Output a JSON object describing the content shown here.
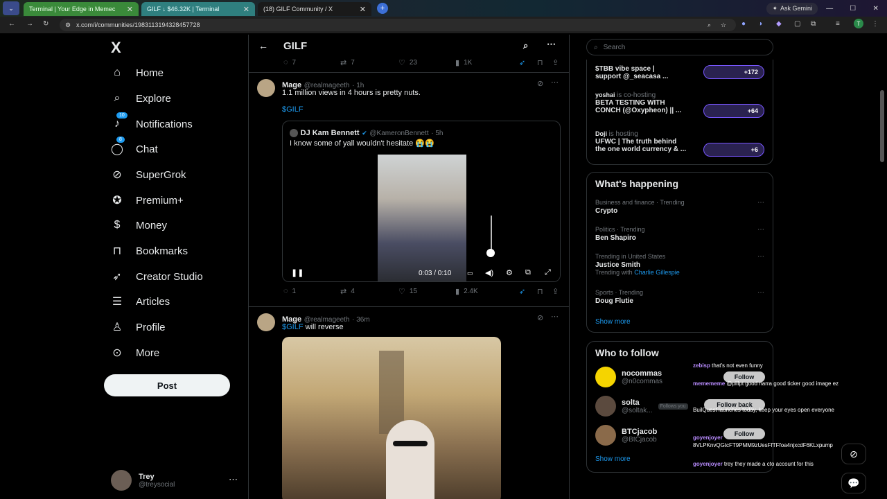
{
  "browser": {
    "tabs": [
      {
        "title": "Terminal | Your Edge in Memec",
        "bg": "#3a8a3a"
      },
      {
        "title": "GILF ↓ $46.32K | Terminal",
        "bg": "#2f7f7f"
      },
      {
        "title": "(18) GILF Community / X",
        "bg": "#222"
      }
    ],
    "new_tab": "+",
    "ask_gemini": "Ask Gemini",
    "url": "x.com/i/communities/1983113194328457728"
  },
  "nav": {
    "logo": "X",
    "items": [
      {
        "label": "Home",
        "icon": "home-icon",
        "glyph": "⌂"
      },
      {
        "label": "Explore",
        "icon": "search-icon",
        "glyph": "⌕"
      },
      {
        "label": "Notifications",
        "icon": "bell-icon",
        "glyph": "🔔",
        "badge": "10"
      },
      {
        "label": "Chat",
        "icon": "chat-icon",
        "glyph": "💬",
        "badge": "8"
      },
      {
        "label": "SuperGrok",
        "icon": "grok-icon",
        "glyph": "⊘"
      },
      {
        "label": "Premium+",
        "icon": "verified-icon",
        "glyph": "✪"
      },
      {
        "label": "Money",
        "icon": "money-icon",
        "glyph": "$"
      },
      {
        "label": "Bookmarks",
        "icon": "bookmark-icon",
        "glyph": "🔖"
      },
      {
        "label": "Creator Studio",
        "icon": "rocket-icon",
        "glyph": "🚀"
      },
      {
        "label": "Articles",
        "icon": "article-icon",
        "glyph": "☰"
      },
      {
        "label": "Profile",
        "icon": "profile-icon",
        "glyph": "👤"
      },
      {
        "label": "More",
        "icon": "more-icon",
        "glyph": "⋯"
      }
    ],
    "post": "Post",
    "me": {
      "name": "Trey",
      "handle": "@treysocial"
    }
  },
  "main": {
    "title": "GILF",
    "top_actions": {
      "replies": "7",
      "reposts": "7",
      "likes": "23",
      "views": "1K"
    },
    "tweet1": {
      "name": "Mage",
      "handle": "@realmageeth",
      "time": "· 1h",
      "text": "1.1 million views in 4 hours is pretty nuts.",
      "cashtag": "$GILF",
      "quote": {
        "name": "DJ Kam Bennett",
        "handle": "@KameronBennett",
        "time": "· 5h",
        "text": "I know some of yall wouldn't hesitate 😭😭",
        "video_time": "0:03 / 0:10"
      },
      "actions": {
        "replies": "1",
        "reposts": "4",
        "likes": "15",
        "views": "2.4K"
      }
    },
    "tweet2": {
      "name": "Mage",
      "handle": "@realmageeth",
      "time": "· 36m",
      "cashtag": "$GILF",
      "text": "will reverse"
    }
  },
  "right": {
    "search_placeholder": "Search",
    "spaces": [
      {
        "host": "",
        "hosting": "",
        "title": "$TBB vibe space |",
        "title2": "support @_seacasa ...",
        "count": "+172"
      },
      {
        "host": "yoshai",
        "hosting": "is co-hosting",
        "title": "BETA TESTING WITH",
        "title2": "CONCH (@Oxypheon) || ...",
        "count": "+64"
      },
      {
        "host": "Doji",
        "hosting": "is hosting",
        "title": "UFWC | The truth behind",
        "title2": "the one world currency & ...",
        "count": "+6"
      }
    ],
    "happening": {
      "title": "What's happening",
      "trends": [
        {
          "meta": "Business and finance · Trending",
          "name": "Crypto",
          "extra": ""
        },
        {
          "meta": "Politics · Trending",
          "name": "Ben Shapiro",
          "extra": ""
        },
        {
          "meta": "Trending in United States",
          "name": "Justice Smith",
          "extra": "Trending with",
          "extra_link": "Charlie Gillespie"
        },
        {
          "meta": "Sports · Trending",
          "name": "Doug Flutie",
          "extra": ""
        }
      ],
      "show_more": "Show more"
    },
    "who": {
      "title": "Who to follow",
      "users": [
        {
          "name": "nocommas",
          "handle": "@n0commas",
          "button": "Follow",
          "color": "#f5d400"
        },
        {
          "name": "solta",
          "handle": "@soltak...",
          "button": "Follow back",
          "note": "Follows you",
          "color": "#5b4a3e"
        },
        {
          "name": "BTCjacob",
          "handle": "@BtCjacob",
          "button": "Follow",
          "color": "#8a6a4a"
        }
      ],
      "show_more": "Show more"
    }
  },
  "chat_overlay": [
    {
      "user": "zebisp",
      "text": "that's not even funny"
    },
    {
      "user": "memememe",
      "text": "@pillpt good narra good ticker good image ez"
    },
    {
      "user": "",
      "text": "BuilQuest launches today, keep your eyes open everyone"
    },
    {
      "user": "goyenjoyer",
      "text": "8VLPKnvQGtcFT9PMM9zUesFfTFfoa4njxcdF6KLxpump"
    },
    {
      "user": "goyenjoyer",
      "text": "trey they made a cto account for this"
    }
  ],
  "colors": {
    "accent": "#1d9bf0",
    "premium": "#7856ff",
    "border": "#2f3336"
  }
}
